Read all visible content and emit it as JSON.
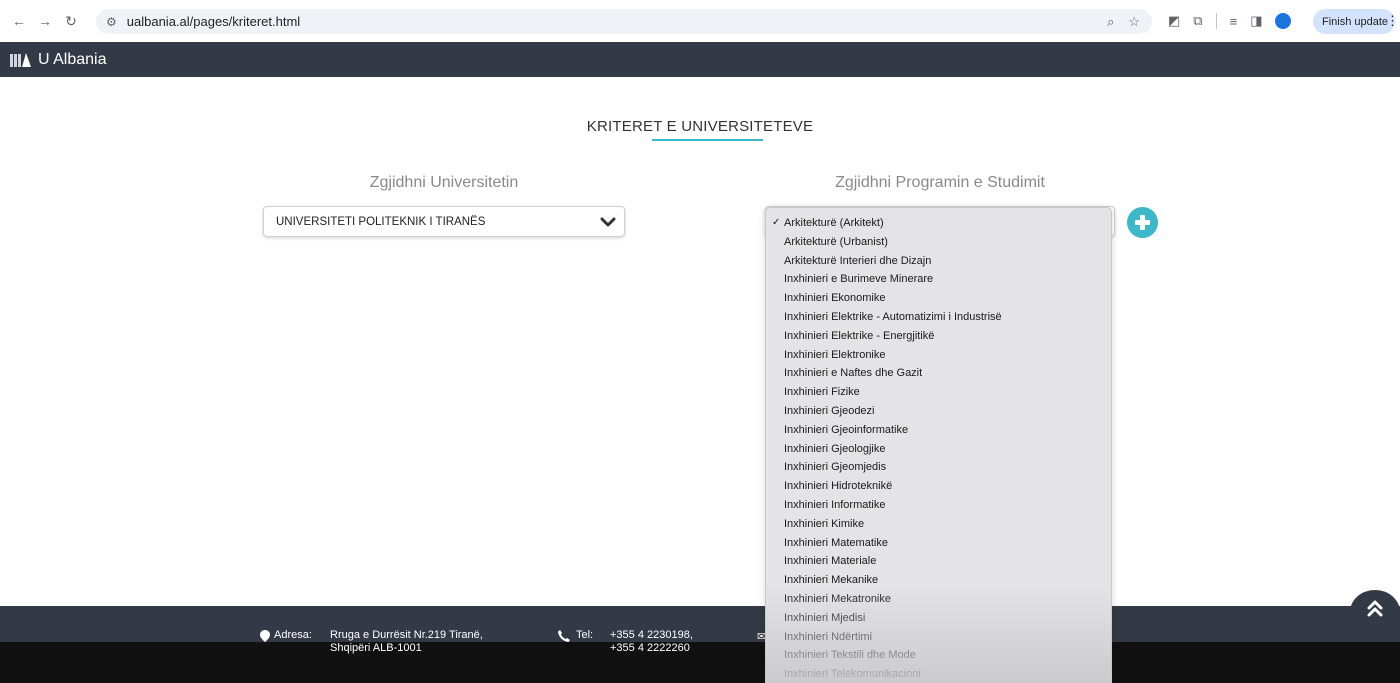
{
  "browser": {
    "url": "ualbania.al/pages/kriteret.html",
    "finish_update_label": "Finish update",
    "profile_initial": "👤"
  },
  "site": {
    "brand": "U Albania",
    "accent_color": "#3db8c8",
    "nav_color": "#343a45"
  },
  "main": {
    "title": "KRITERET E UNIVERSITETEVE",
    "university_label": "Zgjidhni Universitetin",
    "university_selected": "UNIVERSITETI POLITEKNIK I TIRANËS",
    "program_label": "Zgjidhni Programin e Studimit",
    "program_options": [
      "Arkitekturë (Arkitekt)",
      "Arkitekturë (Urbanist)",
      "Arkitekturë Interieri dhe Dizajn",
      "Inxhinieri e Burimeve Minerare",
      "Inxhinieri Ekonomike",
      "Inxhinieri Elektrike - Automatizimi i Industrisë",
      "Inxhinieri Elektrike - Energjitikë",
      "Inxhinieri Elektronike",
      "Inxhinieri e Naftes dhe Gazit",
      "Inxhinieri Fizike",
      "Inxhinieri Gjeodezi",
      "Inxhinieri Gjeoinformatike",
      "Inxhinieri Gjeologjike",
      "Inxhinieri Gjeomjedis",
      "Inxhinieri Hidroteknikë",
      "Inxhinieri Informatike",
      "Inxhinieri Kimike",
      "Inxhinieri Matematike",
      "Inxhinieri Materiale",
      "Inxhinieri Mekanike",
      "Inxhinieri Mekatronike",
      "Inxhinieri Mjedisi",
      "Inxhinieri Ndërtimi",
      "Inxhinieri Tekstili dhe Mode",
      "Inxhinieri Telekomunikacioni"
    ],
    "program_selected_index": 0
  },
  "footer": {
    "address_label": "Adresa:",
    "address_line1": "Rruga e Durrësit Nr.219 Tiranë,",
    "address_line2": "Shqipëri ALB-1001",
    "tel_label": "Tel:",
    "tel_line1": "+355 4 2230198,",
    "tel_line2": "+355 4 2222260"
  }
}
